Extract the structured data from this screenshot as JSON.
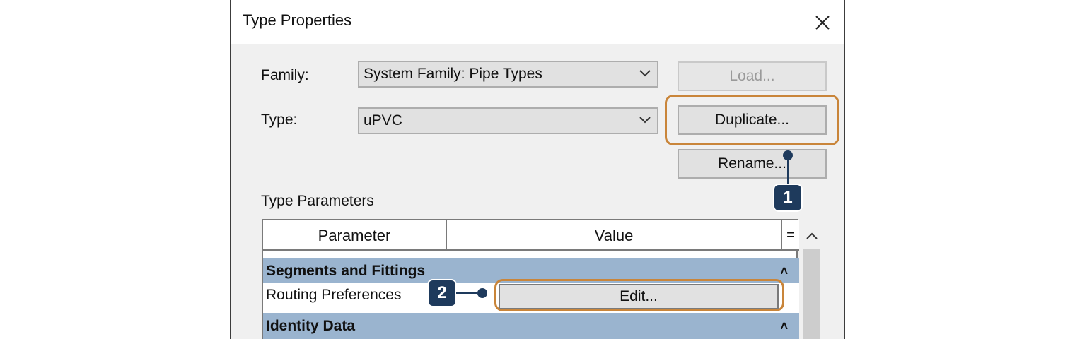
{
  "dialog": {
    "title": "Type Properties",
    "family_label": "Family:",
    "family_value": "System Family: Pipe Types",
    "type_label": "Type:",
    "type_value": "uPVC",
    "load_button": "Load...",
    "duplicate_button": "Duplicate...",
    "rename_button": "Rename...",
    "type_parameters_label": "Type Parameters"
  },
  "grid": {
    "columns": [
      "Parameter",
      "Value",
      "="
    ],
    "groups": [
      {
        "name": "Segments and Fittings"
      },
      {
        "name": "Identity Data"
      }
    ],
    "rows": [
      {
        "parameter": "Routing Preferences",
        "value": "Edit..."
      }
    ]
  },
  "callouts": [
    "1",
    "2"
  ],
  "colors": {
    "group_header": "#9ab4cf",
    "callout": "#1e3a5c",
    "highlight": "#c9853a"
  }
}
